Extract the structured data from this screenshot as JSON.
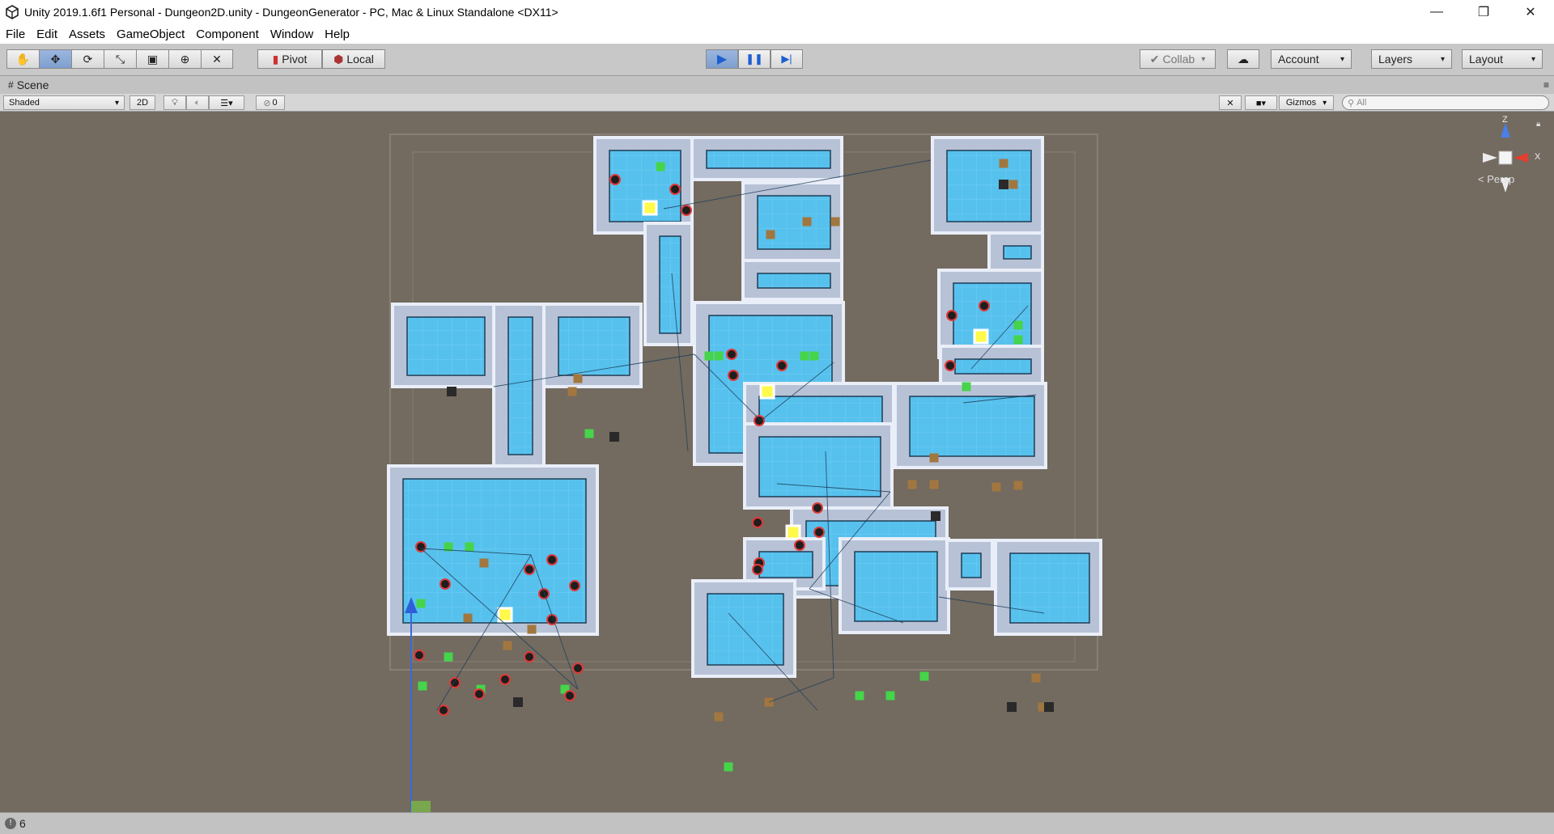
{
  "window": {
    "title": "Unity 2019.1.6f1 Personal - Dungeon2D.unity - DungeonGenerator - PC, Mac & Linux Standalone <DX11>",
    "minimize_glyph": "—",
    "restore_glyph": "❐",
    "close_glyph": "✕"
  },
  "menu": [
    "File",
    "Edit",
    "Assets",
    "GameObject",
    "Component",
    "Window",
    "Help"
  ],
  "toolbar": {
    "tools": [
      {
        "name": "hand-tool",
        "glyph": "✋"
      },
      {
        "name": "move-tool",
        "glyph": "✥"
      },
      {
        "name": "rotate-tool",
        "glyph": "⟳"
      },
      {
        "name": "scale-tool",
        "glyph": "⤡"
      },
      {
        "name": "rect-tool",
        "glyph": "▣"
      },
      {
        "name": "transform-tool",
        "glyph": "⊕"
      },
      {
        "name": "custom-tool",
        "glyph": "✕"
      }
    ],
    "pivot_label": "Pivot",
    "local_label": "Local",
    "play_glyph": "▶",
    "pause_glyph": "❚❚",
    "step_glyph": "▶|",
    "collab_label": "Collab",
    "account_label": "Account",
    "layers_label": "Layers",
    "layout_label": "Layout"
  },
  "scene_tab": {
    "label": "Scene"
  },
  "scene_toolbar": {
    "draw_mode": "Shaded",
    "mode_2d": "2D",
    "hidden_count": "0",
    "gizmos_label": "Gizmos",
    "search_placeholder": "All"
  },
  "gizmo": {
    "z_label": "Z",
    "x_label": "X",
    "projection": "Persp"
  },
  "status": {
    "count": "6"
  },
  "colors": {
    "viewport_bg": "#736a60",
    "floor": "#57c1ee",
    "wall": "#e9eef8",
    "wall_shadow": "#b8c2d6",
    "play_active": "#7f9fd0"
  }
}
